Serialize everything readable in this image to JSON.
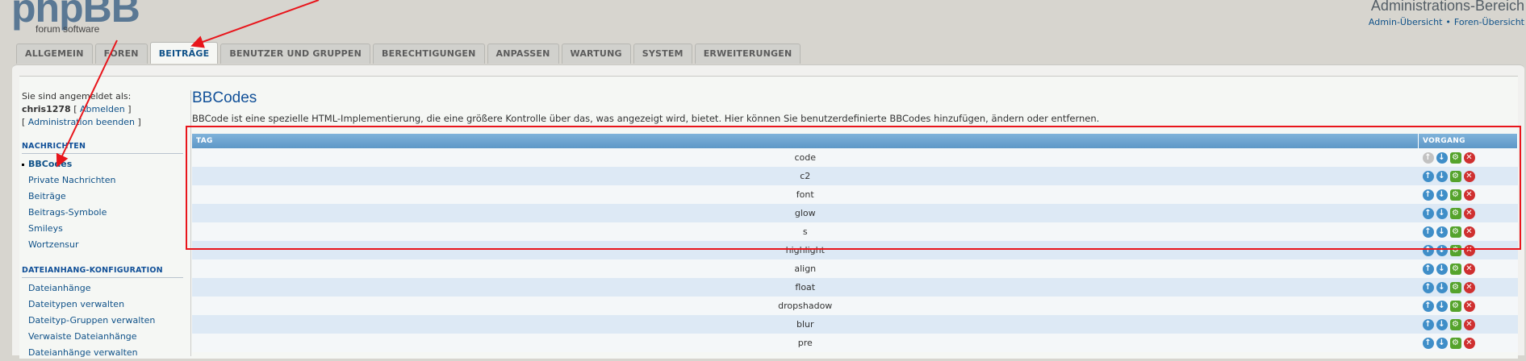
{
  "header": {
    "logo_text": "phpBB",
    "logo_sub": "forum software",
    "admin_title": "Administrations-Bereich",
    "link_admin": "Admin-Übersicht",
    "link_sep": "•",
    "link_forum": "Foren-Übersicht"
  },
  "tabs": [
    "ALLGEMEIN",
    "FOREN",
    "BEITRÄGE",
    "BENUTZER UND GRUPPEN",
    "BERECHTIGUNGEN",
    "ANPASSEN",
    "WARTUNG",
    "SYSTEM",
    "ERWEITERUNGEN"
  ],
  "active_tab": "BEITRÄGE",
  "sidebar": {
    "logged_in_label": "Sie sind angemeldet als:",
    "username": "chris1278",
    "logout": "Abmelden",
    "end_admin": "Administration beenden",
    "section1_title": "NACHRICHTEN",
    "section1_items": [
      "BBCodes",
      "Private Nachrichten",
      "Beiträge",
      "Beitrags-Symbole",
      "Smileys",
      "Wortzensur"
    ],
    "section2_title": "DATEIANHANG-KONFIGURATION",
    "section2_items": [
      "Dateianhänge",
      "Dateitypen verwalten",
      "Dateityp-Gruppen verwalten",
      "Verwaiste Dateianhänge",
      "Dateianhänge verwalten"
    ]
  },
  "main": {
    "title": "BBCodes",
    "description": "BBCode ist eine spezielle HTML-Implementierung, die eine größere Kontrolle über das, was angezeigt wird, bietet. Hier können Sie benutzerdefinierte BBCodes hinzufügen, ändern oder entfernen.",
    "col_tag": "TAG",
    "col_action": "VORGANG",
    "rows": [
      "code",
      "c2",
      "font",
      "glow",
      "s",
      "highlight",
      "align",
      "float",
      "dropshadow",
      "blur",
      "pre"
    ]
  },
  "colors": {
    "accent": "#105289",
    "table_header": "#69a3d0",
    "annotation": "#e8151b"
  }
}
